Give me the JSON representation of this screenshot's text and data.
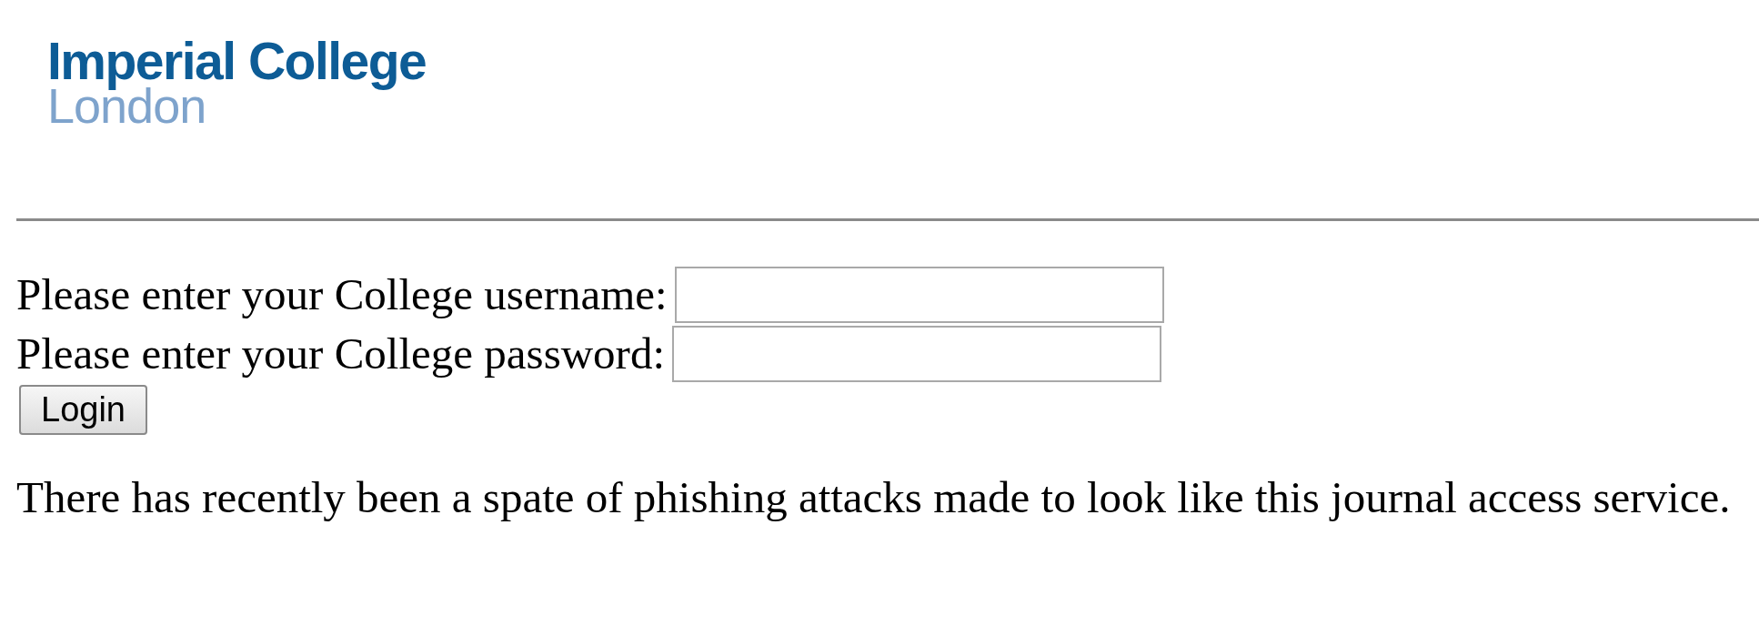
{
  "logo": {
    "name": "Imperial College",
    "place": "London"
  },
  "form": {
    "fields": [
      {
        "label": "Please enter your College username:"
      },
      {
        "label": "Please enter your College password:"
      }
    ],
    "button": "Login"
  },
  "notice": "There has recently been a spate of phishing attacks made to look like this journal access service."
}
